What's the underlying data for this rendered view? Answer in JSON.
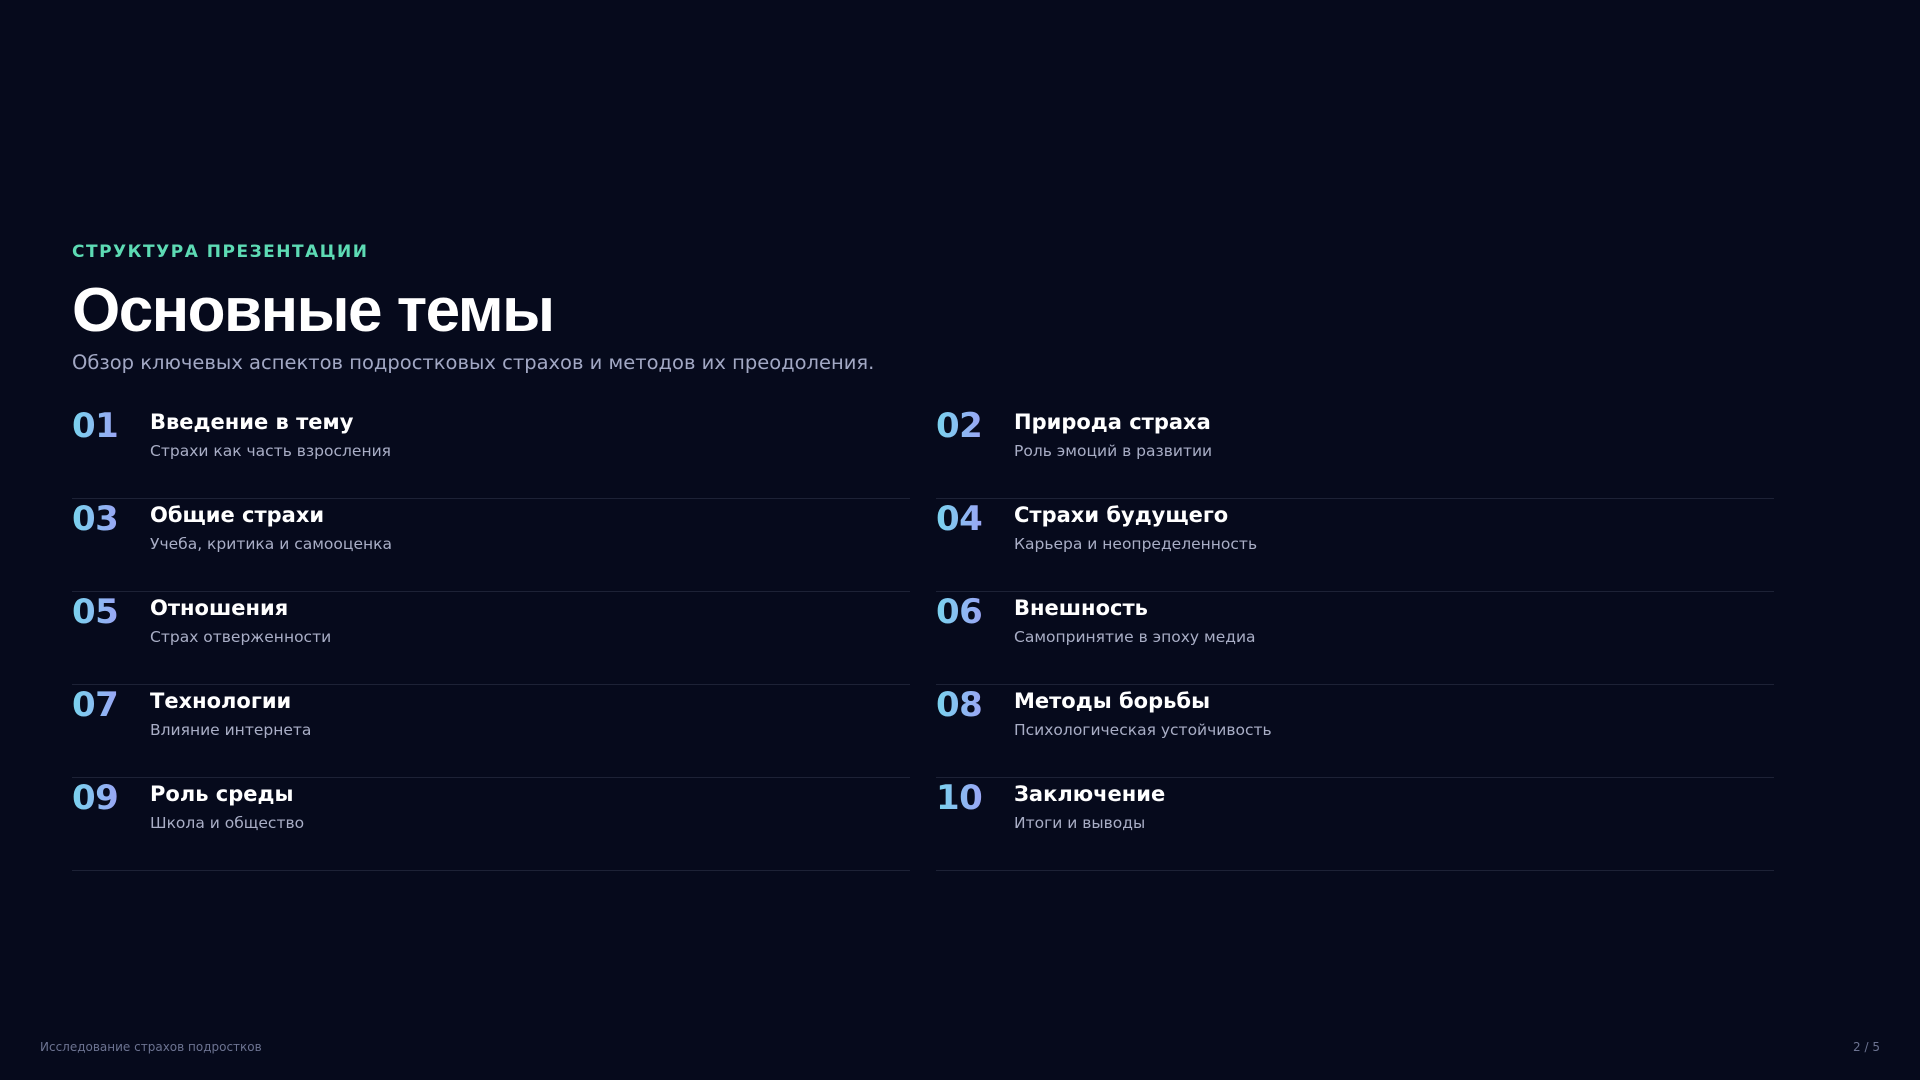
{
  "header": {
    "eyebrow": "СТРУКТУРА ПРЕЗЕНТАЦИИ",
    "title": "Основные темы",
    "subtitle": "Обзор ключевых аспектов подростковых страхов и методов их преодоления."
  },
  "topics": [
    {
      "number": "01",
      "title": "Введение в тему",
      "description": "Страхи как часть взросления"
    },
    {
      "number": "02",
      "title": "Природа страха",
      "description": "Роль эмоций в развитии"
    },
    {
      "number": "03",
      "title": "Общие страхи",
      "description": "Учеба, критика и самооценка"
    },
    {
      "number": "04",
      "title": "Страхи будущего",
      "description": "Карьера и неопределенность"
    },
    {
      "number": "05",
      "title": "Отношения",
      "description": "Страх отверженности"
    },
    {
      "number": "06",
      "title": "Внешность",
      "description": "Самопринятие в эпоху медиа"
    },
    {
      "number": "07",
      "title": "Технологии",
      "description": "Влияние интернета"
    },
    {
      "number": "08",
      "title": "Методы борьбы",
      "description": "Психологическая устойчивость"
    },
    {
      "number": "09",
      "title": "Роль среды",
      "description": "Школа и общество"
    },
    {
      "number": "10",
      "title": "Заключение",
      "description": "Итоги и выводы"
    }
  ],
  "footer": {
    "left": "Исследование страхов подростков",
    "page": "2 / 5"
  },
  "colors": {
    "background": "#060a1c",
    "accent": "#5ddbb4",
    "number_gradient_start": "#79d3ee",
    "number_gradient_end": "#9aa6f5",
    "divider": "#1d2236"
  }
}
